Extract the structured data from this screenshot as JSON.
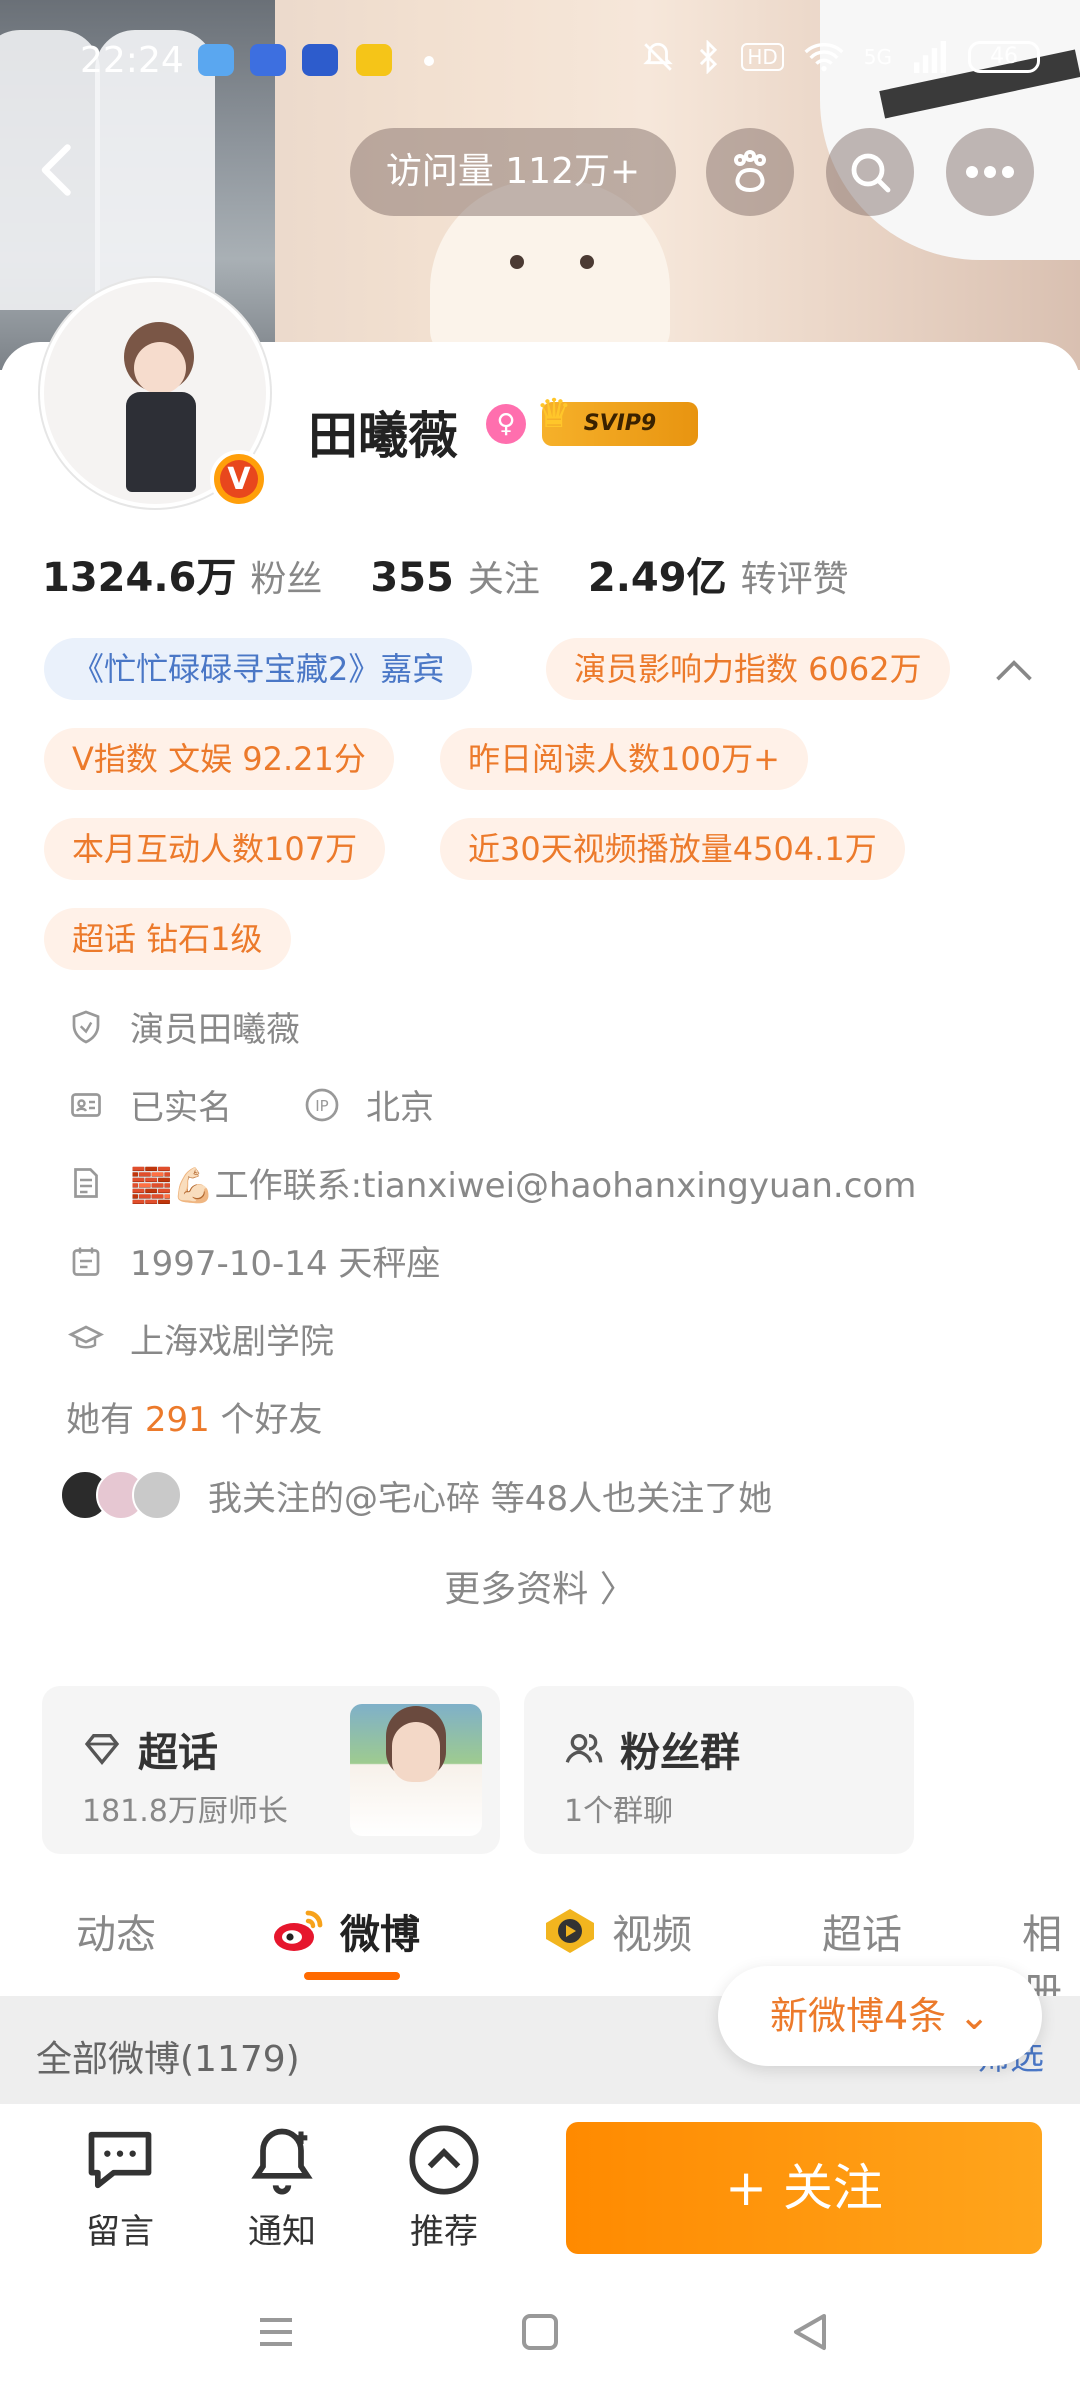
{
  "status_bar": {
    "time": "22:24",
    "network": "5G",
    "hd": "HD",
    "battery": "46"
  },
  "header": {
    "visits": "访问量 112万+"
  },
  "profile": {
    "name": "田曦薇",
    "gender_icon": "female-icon",
    "vip_badge": "SVIP9",
    "verified_badge": "V",
    "stats": [
      {
        "value": "1324.6万",
        "label": "粉丝"
      },
      {
        "value": "355",
        "label": "关注"
      },
      {
        "value": "2.49亿",
        "label": "转评赞"
      }
    ],
    "tags": {
      "guest": "《忙忙碌碌寻宝藏2》嘉宾",
      "influence": "演员影响力指数 6062万",
      "v_index": "V指数 文娱 92.21分",
      "yesterday_reads": "昨日阅读人数100万+",
      "month_interactions": "本月互动人数107万",
      "video_plays": "近30天视频播放量4504.1万",
      "super_topic": "超话 钻石1级"
    },
    "info": {
      "verification": "演员田曦薇",
      "real_name": "已实名",
      "ip_location": "北京",
      "bio": "🧱💪🏻工作联系:tianxiwei@haohanxingyuan.com",
      "birthday": "1997-10-14 天秤座",
      "school": "上海戏剧学院"
    },
    "friends": {
      "prefix": "她有",
      "count": "291",
      "suffix": "个好友"
    },
    "mutual": "我关注的@宅心碎 等48人也关注了她",
    "more_info": "更多资料 〉"
  },
  "features": {
    "super_topic": {
      "title": "超话",
      "subtitle": "181.8万厨师长"
    },
    "fan_group": {
      "title": "粉丝群",
      "subtitle": "1个群聊"
    }
  },
  "tabs": [
    "动态",
    "微博",
    "视频",
    "超话",
    "相册"
  ],
  "active_tab": "微博",
  "feed": {
    "all_label": "全部微博(1179)",
    "filter_label": "筛选",
    "new_posts": "新微博4条 ⌄"
  },
  "bottom_bar": {
    "message": "留言",
    "notify": "通知",
    "recommend": "推荐",
    "follow": "+ 关注"
  },
  "colors": {
    "accent": "#ff8a00",
    "tag_orange_text": "#ec7a2b",
    "tag_blue_text": "#4a77c6"
  }
}
